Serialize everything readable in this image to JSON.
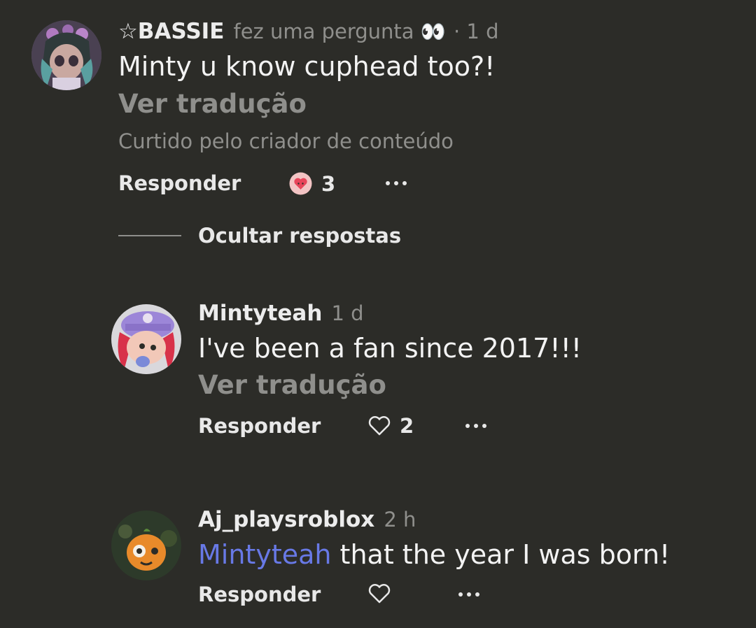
{
  "comments": [
    {
      "author": "☆BASSIE",
      "action": "fez uma pergunta 👀",
      "age": "· 1 d",
      "text": "Minty u know cuphead too?!",
      "translate": "Ver tradução",
      "liked_by": "Curtido pelo criador de conteúdo",
      "reply_label": "Responder",
      "likes": "3"
    }
  ],
  "hide_replies": "Ocultar respostas",
  "replies": [
    {
      "author": "Mintyteah",
      "age": "1 d",
      "text": "I've been a fan since 2017!!!",
      "translate": "Ver tradução",
      "reply_label": "Responder",
      "likes": "2"
    },
    {
      "author": "Aj_playsroblox",
      "age": "2 h",
      "mention": "Mintyteah",
      "text": " that the year I was born!",
      "reply_label": "Responder"
    }
  ],
  "icons": {
    "liked_heart": "heart-filled-icon",
    "heart": "heart-outline-icon",
    "more": "more-options-icon"
  },
  "colors": {
    "background": "#2c2c28",
    "mention": "#6879e6",
    "liked_heart": "#e8455a"
  }
}
